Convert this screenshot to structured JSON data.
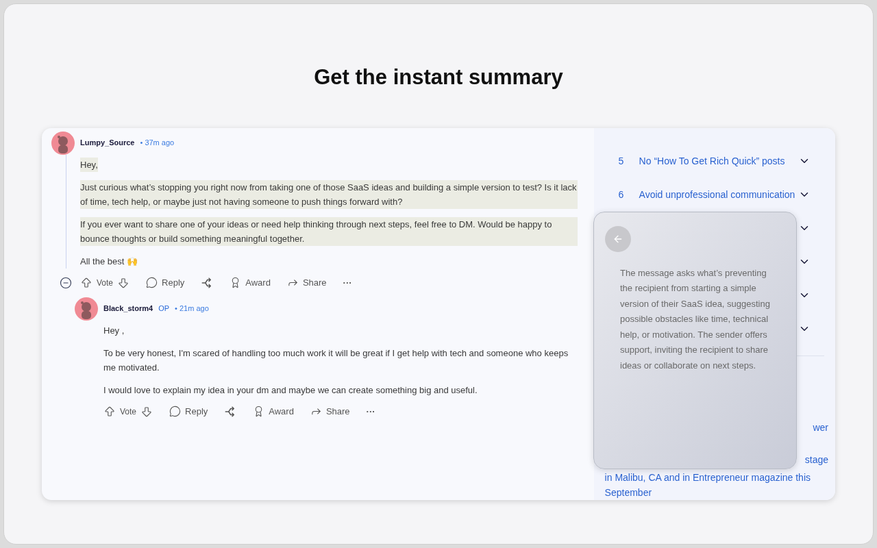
{
  "headline": "Get the instant summary",
  "comments": [
    {
      "author": "Lumpy_Source",
      "time": "• 37m ago",
      "collapsible": true,
      "paragraphs": [
        {
          "text": "Hey,",
          "highlighted": true
        },
        {
          "text": "Just curious what’s stopping you right now from taking one of those SaaS ideas and building a simple version to test? Is it lack of time, tech help, or maybe just not having someone to push things forward with?",
          "highlighted": true
        },
        {
          "text": "If you ever want to share one of your ideas or need help thinking through next steps, feel free to DM. Would be happy to bounce thoughts or build something meaningful together.",
          "highlighted": true
        },
        {
          "text": "All the best 🙌",
          "highlighted": false
        }
      ],
      "actions": {
        "vote": "Vote",
        "reply": "Reply",
        "award": "Award",
        "share": "Share",
        "more": "···"
      },
      "replies": [
        {
          "author": "Black_storm4",
          "badge": "OP",
          "time": "• 21m ago",
          "paragraphs": [
            {
              "text": "Hey ,",
              "highlighted": false
            },
            {
              "text": "To be very honest, I'm scared of handling too much work it will be great if I get help with tech and someone who keeps me motivated.",
              "highlighted": false
            },
            {
              "text": "I would love to explain my idea in your dm and maybe we can create something big and useful.",
              "highlighted": false
            }
          ],
          "actions": {
            "vote": "Vote",
            "reply": "Reply",
            "award": "Award",
            "share": "Share",
            "more": "···"
          }
        }
      ]
    }
  ],
  "sidebar": {
    "rules": [
      {
        "number": "5",
        "title": "No “How To Get Rich Quick” posts",
        "expanded": false
      },
      {
        "number": "6",
        "title": "Avoid unprofessional communication",
        "expanded": false
      },
      {
        "expanded": false
      },
      {
        "expanded": false
      },
      {
        "expanded": false
      },
      {
        "expanded": false
      }
    ],
    "fragments": [
      "wer",
      "stage"
    ],
    "lines": [
      "in Malibu, CA and in Entrepreneur magazine this",
      "September"
    ]
  },
  "summary": {
    "text": "The message asks what’s preventing the recipient from starting a simple version of their SaaS idea, suggesting possible obstacles like time, technical help, or motivation. The sender offers support, inviting the recipient to share ideas or collaborate on next steps."
  }
}
